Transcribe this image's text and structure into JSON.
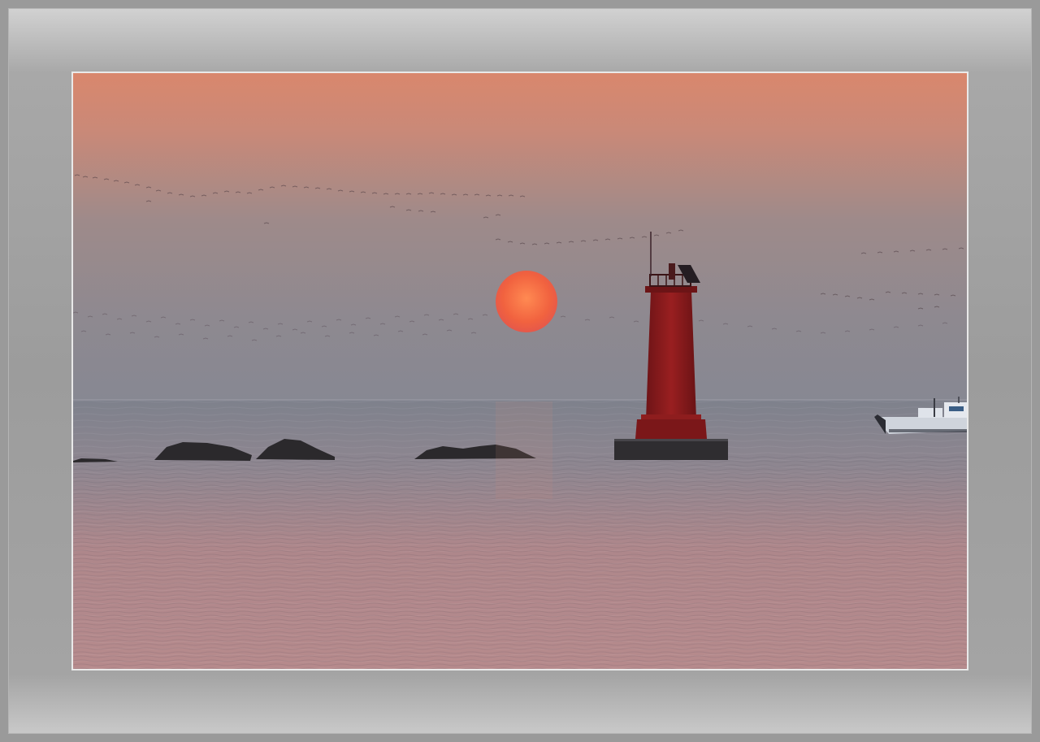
{
  "scene": {
    "subject": "lighthouse-at-sunset",
    "colors": {
      "sky_top": "#d98970",
      "sky_mid": "#a28b87",
      "sky_low": "#8d8890",
      "horizon": "#888893",
      "sea_far": "#7c7f8a",
      "sea_near": "#b8878a",
      "sun": "#f26a4a",
      "lighthouse": "#8a1b1c",
      "rock": "#2c2a2c",
      "mat": "#9c9c9c"
    }
  }
}
